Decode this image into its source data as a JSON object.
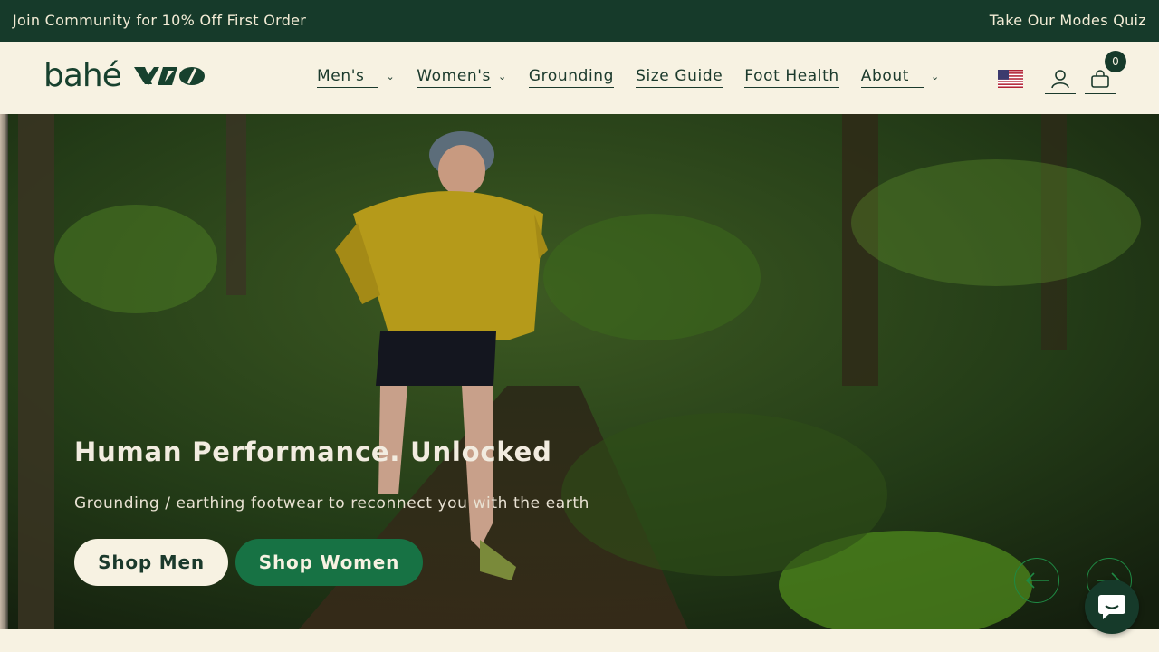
{
  "announcement": {
    "left": "Join Community for 10% Off First Order",
    "right": "Take Our Modes Quiz"
  },
  "logo": {
    "text": "bahé"
  },
  "nav": {
    "items": [
      {
        "label": "Men's",
        "dropdown": true
      },
      {
        "label": "Women's",
        "dropdown": true
      },
      {
        "label": "Grounding",
        "dropdown": false
      },
      {
        "label": "Size Guide",
        "dropdown": false
      },
      {
        "label": "Foot Health",
        "dropdown": false
      },
      {
        "label": "About",
        "dropdown": true
      }
    ]
  },
  "utils": {
    "flag": "us-flag-icon",
    "account_icon": "account-icon",
    "cart_icon": "cart-icon",
    "cart_count": "0"
  },
  "hero": {
    "title": "Human Performance. Unlocked",
    "subtitle": "Grounding / earthing footwear to reconnect you with the earth",
    "primary_button": "Shop Men",
    "secondary_button": "Shop Women",
    "prev_icon": "arrow-left-icon",
    "next_icon": "arrow-right-icon"
  },
  "colors": {
    "brand_dark": "#163a2a",
    "cream": "#f7f2e2",
    "accent_green": "#177244"
  }
}
